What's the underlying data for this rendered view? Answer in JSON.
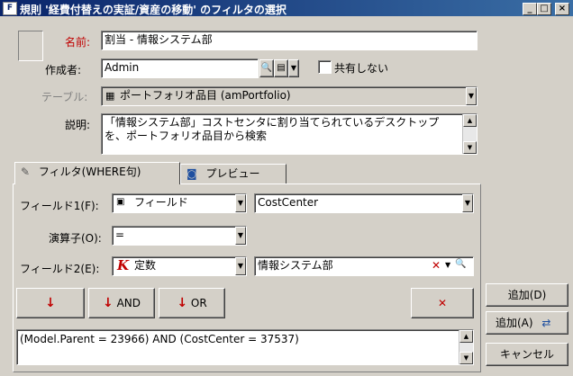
{
  "window": {
    "title": "規則 '経費付替えの実証/資産の移動' のフィルタの選択",
    "min_label": "_",
    "max_label": "□",
    "close_label": "×"
  },
  "form": {
    "name_label": "名前:",
    "name_value": "割当 - 情報システム部",
    "author_label": "作成者:",
    "author_value": "Admin",
    "noshare_label": "共有しない",
    "table_label": "テーブル:",
    "table_value": "ポートフォリオ品目 (amPortfolio)",
    "desc_label": "説明:",
    "desc_value": "「情報システム部」コストセンタに割り当てられているデスクトップを、ポートフォリオ品目から検索"
  },
  "tabs": {
    "filter": "フィルタ(WHERE句)",
    "preview": "プレビュー"
  },
  "filter": {
    "field1_label": "フィールド1(F):",
    "field1_type": "フィールド",
    "field1_value": "CostCenter",
    "operator_label": "演算子(O):",
    "operator_value": "=",
    "field2_label": "フィールド2(E):",
    "field2_type": "定数",
    "field2_value": "情報システム部",
    "and_label": "AND",
    "or_label": "OR",
    "expression": "(Model.Parent = 23966) AND (CostCenter = 37537)"
  },
  "buttons": {
    "add": "追加(D)",
    "add_a": "追加(A)",
    "cancel": "キャンセル"
  },
  "colors": {
    "titlebar": "#0a246a",
    "accent_red": "#c00000",
    "face": "#d4d0c8"
  }
}
